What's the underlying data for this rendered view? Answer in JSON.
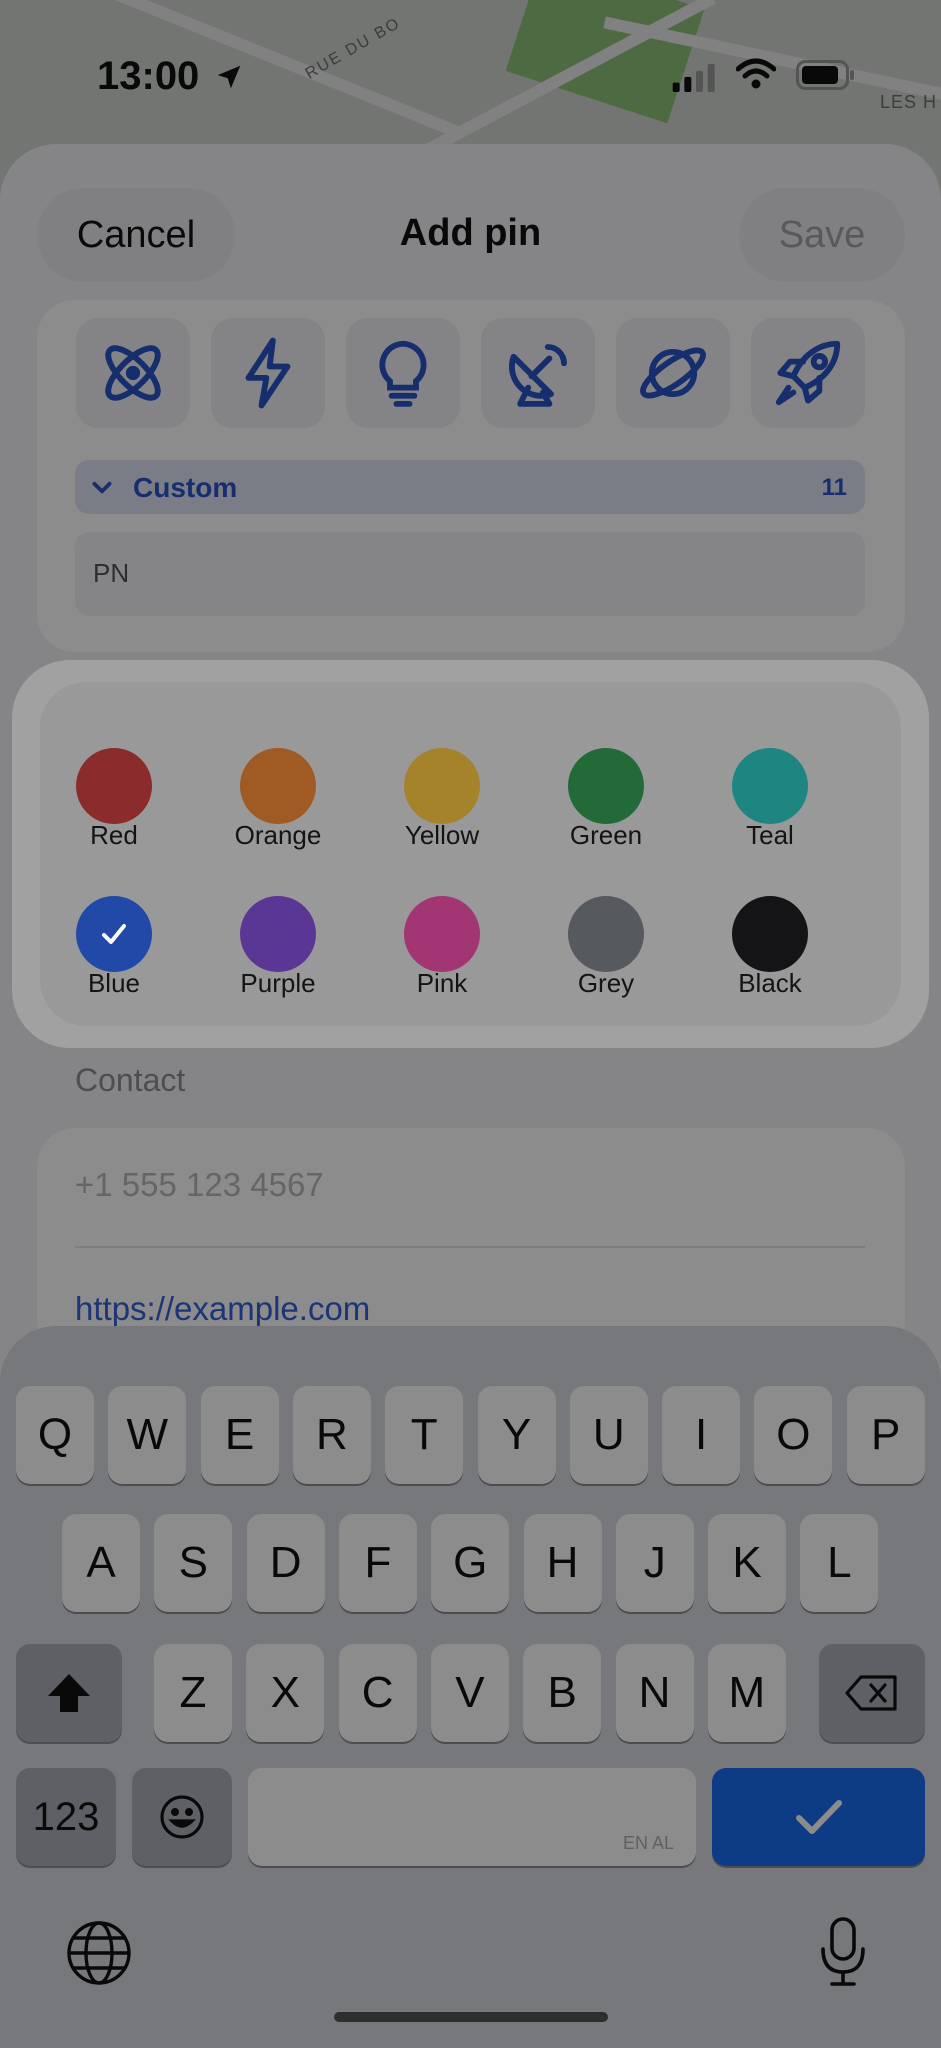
{
  "status_bar": {
    "time": "13:00"
  },
  "map": {
    "street_label": "RUE DU BO",
    "place_label": "LES H"
  },
  "sheet": {
    "cancel_label": "Cancel",
    "title": "Add pin",
    "save_label": "Save",
    "icons": [
      "atom-icon",
      "bolt-icon",
      "lightbulb-icon",
      "satellite-dish-icon",
      "planet-icon",
      "rocket-icon"
    ],
    "accent_color": "#2a54c9",
    "category": {
      "label": "Custom",
      "count": "11"
    },
    "name_value": "PN"
  },
  "contact": {
    "section_label": "Contact",
    "phone_placeholder": "+1 555 123 4567",
    "url_value": "https://example.com"
  },
  "color_picker": {
    "selected": "Blue",
    "colors": [
      {
        "name": "Red",
        "hex": "#8b2b2b"
      },
      {
        "name": "Orange",
        "hex": "#a05a24"
      },
      {
        "name": "Yellow",
        "hex": "#a4832b"
      },
      {
        "name": "Green",
        "hex": "#226b39"
      },
      {
        "name": "Teal",
        "hex": "#1f8580"
      },
      {
        "name": "Blue",
        "hex": "#2149a7"
      },
      {
        "name": "Purple",
        "hex": "#5b3795"
      },
      {
        "name": "Pink",
        "hex": "#a23672"
      },
      {
        "name": "Grey",
        "hex": "#56595e"
      },
      {
        "name": "Black",
        "hex": "#141416"
      }
    ]
  },
  "keyboard": {
    "row1": [
      "Q",
      "W",
      "E",
      "R",
      "T",
      "Y",
      "U",
      "I",
      "O",
      "P"
    ],
    "row2": [
      "A",
      "S",
      "D",
      "F",
      "G",
      "H",
      "J",
      "K",
      "L"
    ],
    "row3": [
      "Z",
      "X",
      "C",
      "V",
      "B",
      "N",
      "M"
    ],
    "numbers_label": "123",
    "space_hint": "EN AL",
    "done_color": "#1a6df0"
  }
}
